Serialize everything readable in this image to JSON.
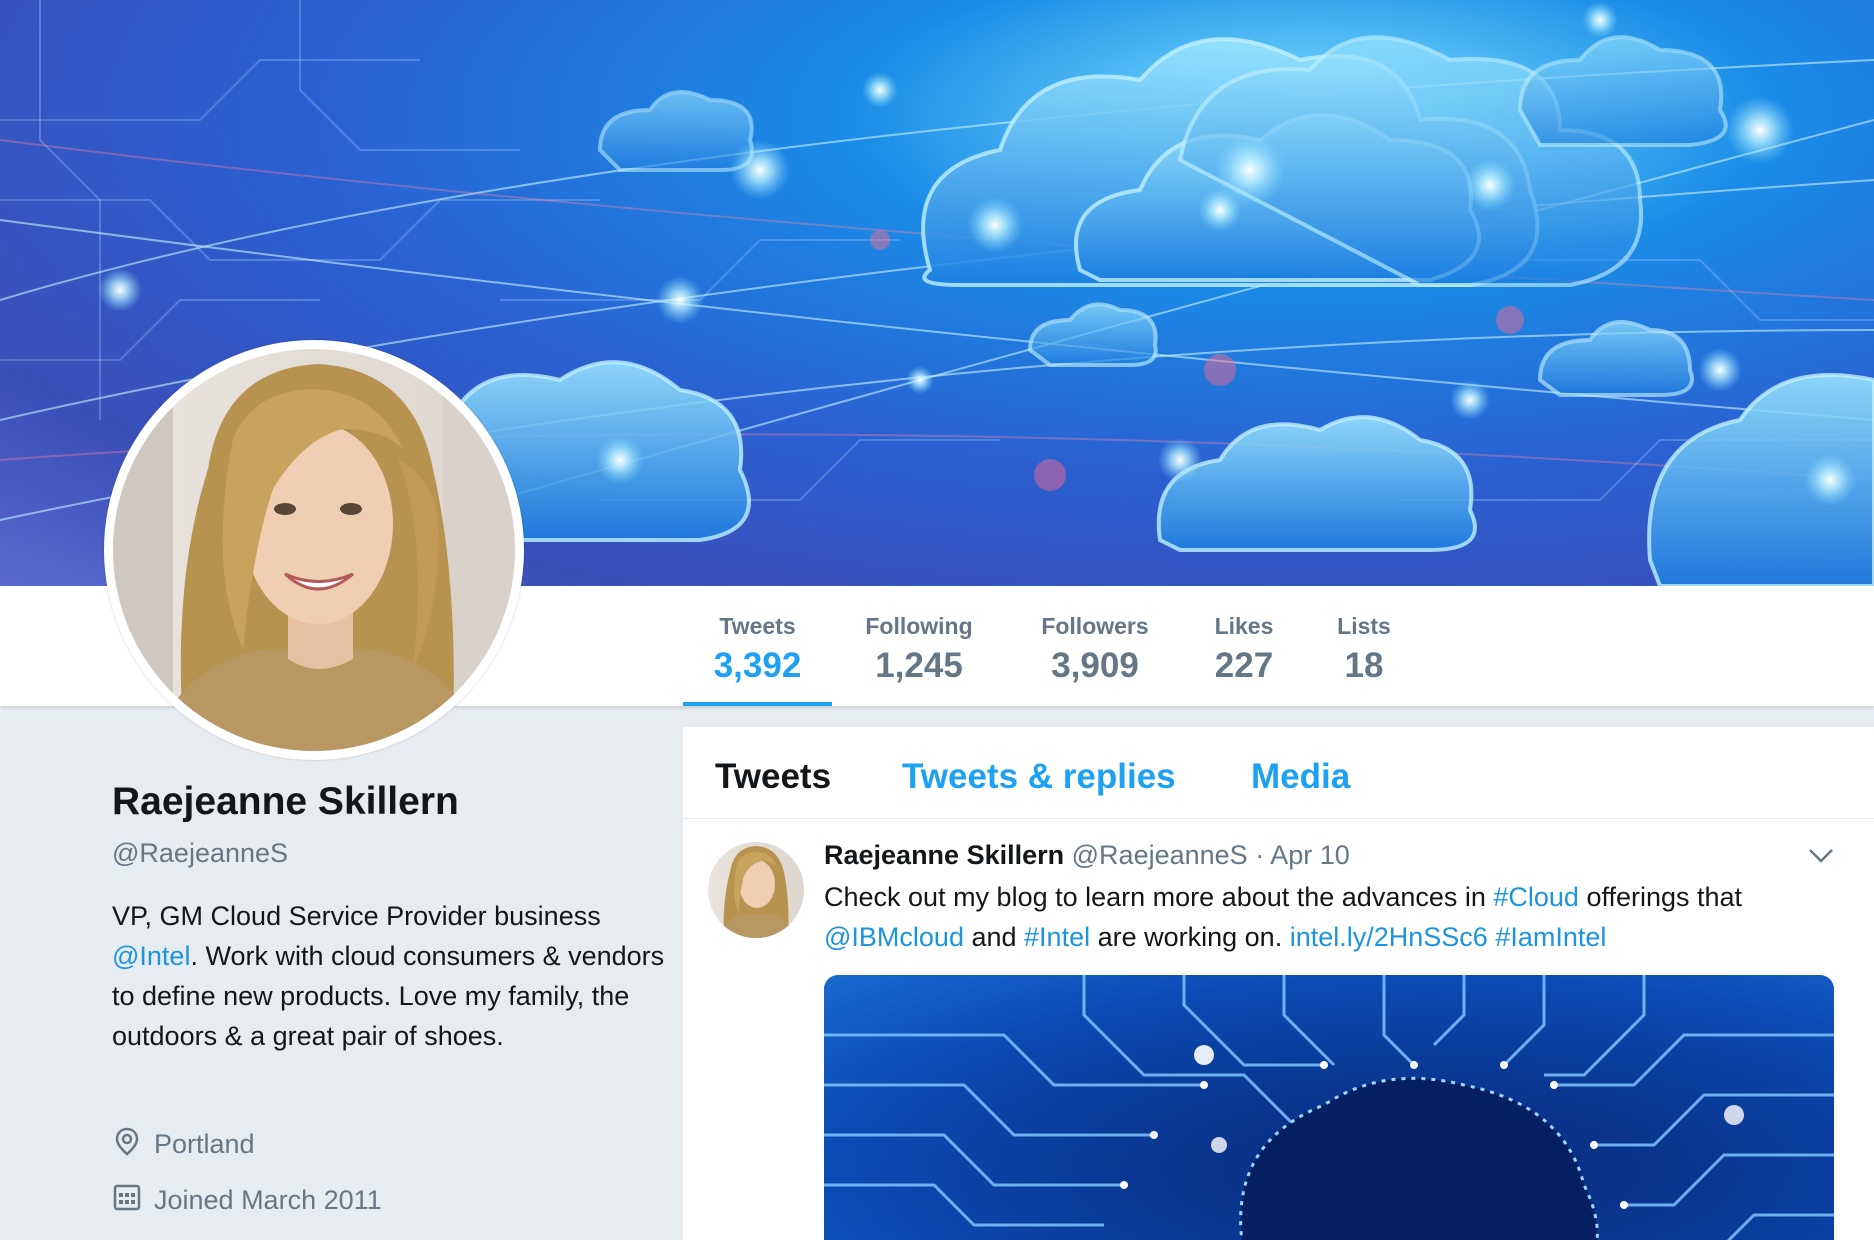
{
  "profile": {
    "name": "Raejeanne Skillern",
    "handle": "@RaejeanneS",
    "bio_part1": "VP, GM Cloud Service Provider business ",
    "bio_mention": "@Intel",
    "bio_part2": ". Work with cloud consumers & vendors to define new products. Love my family, the outdoors & a great pair of shoes.",
    "location": "Portland",
    "joined": "Joined March 2011",
    "location_icon": "location-pin-icon",
    "joined_icon": "calendar-icon"
  },
  "stats": [
    {
      "label": "Tweets",
      "value": "3,392",
      "active": true
    },
    {
      "label": "Following",
      "value": "1,245",
      "active": false
    },
    {
      "label": "Followers",
      "value": "3,909",
      "active": false
    },
    {
      "label": "Likes",
      "value": "227",
      "active": false
    },
    {
      "label": "Lists",
      "value": "18",
      "active": false
    }
  ],
  "tabs": [
    {
      "label": "Tweets",
      "active": true
    },
    {
      "label": "Tweets & replies",
      "active": false
    },
    {
      "label": "Media",
      "active": false
    }
  ],
  "tweet": {
    "author": "Raejeanne Skillern",
    "handle": "@RaejeanneS",
    "separator": "·",
    "date": "Apr 10",
    "text_1": "Check out my blog to learn more about the advances in ",
    "hashtag_cloud": "#Cloud",
    "text_2": " offerings that ",
    "mention_ibm": "@IBMcloud",
    "text_3": " and ",
    "hashtag_intel": "#Intel",
    "text_4": " are working on. ",
    "link": "intel.ly/2HnSSc6",
    "text_5": " ",
    "hashtag_iamintel": "#IamIntel",
    "caret_icon": "chevron-down-icon"
  },
  "colors": {
    "accent": "#1da1f2",
    "link": "#1b95e0",
    "text": "#14171a",
    "muted": "#657786",
    "background": "#e6ecf0"
  }
}
